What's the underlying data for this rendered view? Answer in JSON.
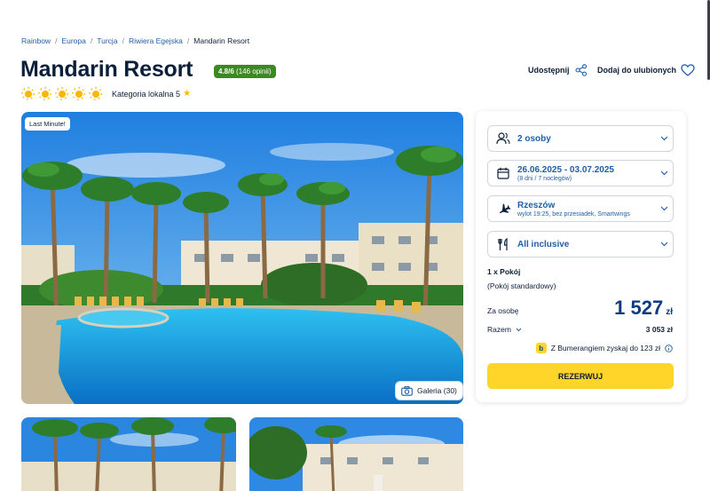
{
  "breadcrumb": [
    "Rainbow",
    "Europa",
    "Turcja",
    "Riwiera Egejska",
    "Mandarin Resort"
  ],
  "hotel": {
    "name": "Mandarin Resort",
    "rating_score": "4.8/6",
    "rating_reviews": "(146 opinii)",
    "suns": 5,
    "local_category": "Kategoria lokalna 5"
  },
  "actions": {
    "share": "Udostępnij",
    "favorite": "Dodaj do ulubionych"
  },
  "gallery": {
    "badge": "Last Minute!",
    "button": "Galeria (30)"
  },
  "booking": {
    "persons": "2 osoby",
    "dates": "26.06.2025 - 03.07.2025",
    "dates_sub": "(8 dni / 7 noclegów)",
    "departure": "Rzeszów",
    "departure_sub": "wylot 19:25, bez przesiadek, Smartwings",
    "board": "All inclusive",
    "room_count": "1 x Pokój",
    "room_type": "(Pokój standardowy)",
    "per_person_label": "Za osobę",
    "per_person_price": "1 527",
    "currency": "zł",
    "total_label": "Razem",
    "total_value": "3 053 zł",
    "bumerang_text": "Z Bumerangiem zyskaj do 123 zł",
    "book_button": "REZERWUJ"
  },
  "colors": {
    "primary": "#1f5fa8",
    "accent": "#ffd52a",
    "badge_green": "#3a8a1f",
    "sun": "#f7b900"
  }
}
